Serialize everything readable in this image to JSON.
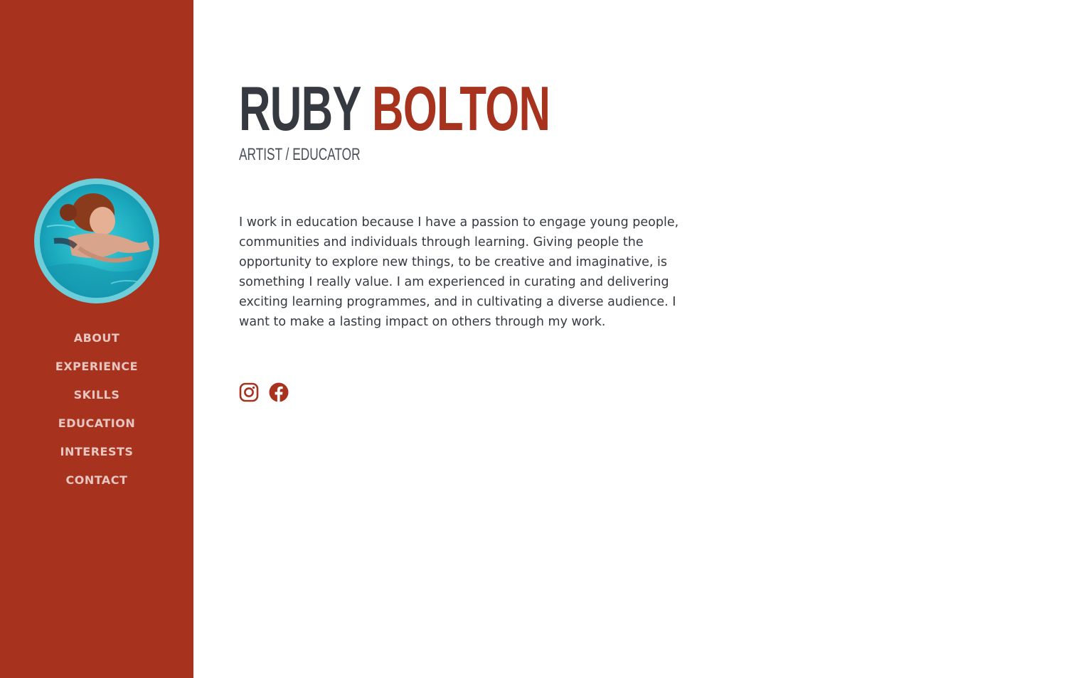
{
  "profile": {
    "first_name": "RUBY",
    "last_name": "BOLTON",
    "subtitle": "ARTIST / EDUCATOR",
    "bio": "I work in education because I have a passion to engage young people, communities and individuals through learning. Giving people the opportunity to explore new things, to be creative and imaginative, is something I really value. I am experienced in curating and delivering exciting learning programmes, and in cultivating a diverse audience. I want to make a lasting impact on others through my work."
  },
  "nav": {
    "items": [
      {
        "label": "ABOUT"
      },
      {
        "label": "EXPERIENCE"
      },
      {
        "label": "SKILLS"
      },
      {
        "label": "EDUCATION"
      },
      {
        "label": "INTERESTS"
      },
      {
        "label": "CONTACT"
      }
    ]
  },
  "social": [
    {
      "icon": "instagram-icon"
    },
    {
      "icon": "facebook-icon"
    }
  ],
  "colors": {
    "brand": "#a7321e",
    "heading": "#343a40",
    "text": "#343a40",
    "nav_text": "rgba(255,255,255,0.72)"
  }
}
